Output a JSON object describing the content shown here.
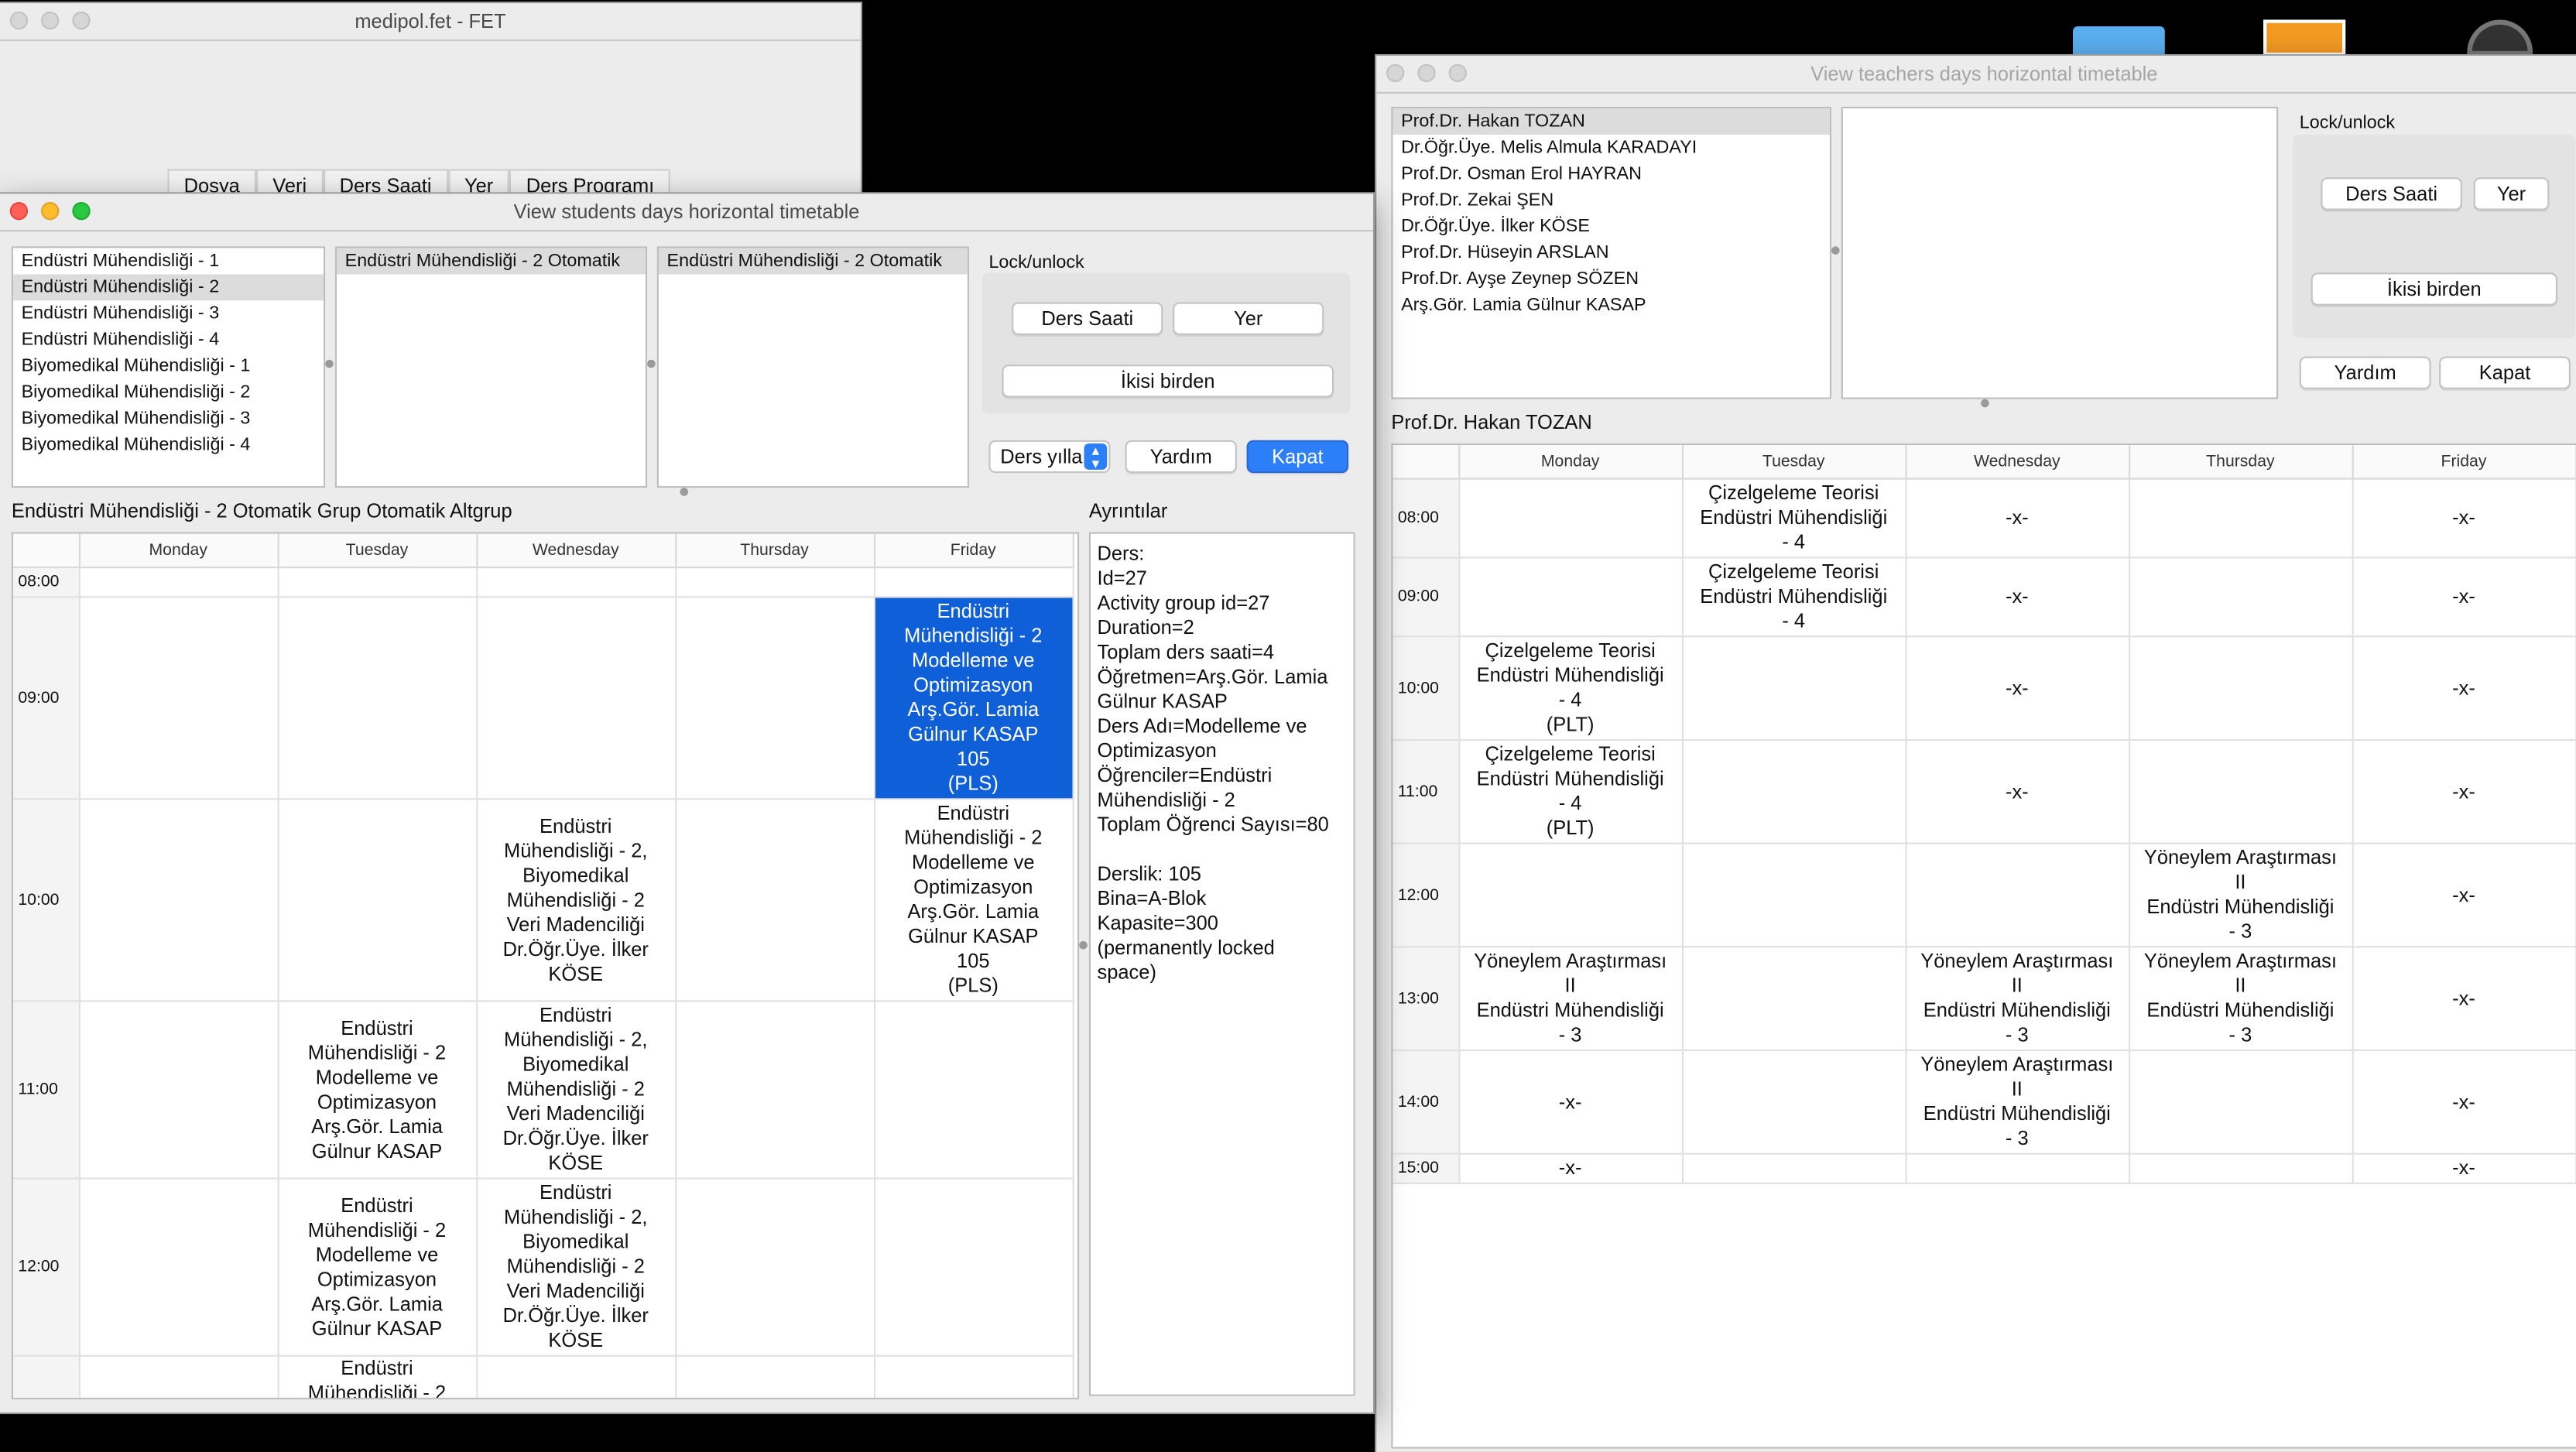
{
  "desktop": {
    "icons": [
      "folder-icon",
      "document-icon",
      "drive-icon"
    ]
  },
  "main_window": {
    "title": "medipol.fet - FET",
    "menu": [
      "Dosya",
      "Veri",
      "Ders Saati",
      "Yer",
      "Ders Programı"
    ]
  },
  "students_window": {
    "title": "View students days horizontal timetable",
    "year_list": [
      "Endüstri Mühendisliği - 1",
      "Endüstri Mühendisliği - 2",
      "Endüstri Mühendisliği - 3",
      "Endüstri Mühendisliği - 4",
      "Biyomedikal Mühendisliği - 1",
      "Biyomedikal Mühendisliği - 2",
      "Biyomedikal Mühendisliği - 3",
      "Biyomedikal Mühendisliği - 4"
    ],
    "group_list": [
      "Endüstri Mühendisliği - 2 Otomatik"
    ],
    "subgroup_list": [
      "Endüstri Mühendisliği - 2 Otomatik"
    ],
    "lock_label": "Lock/unlock",
    "btn_ders_saati": "Ders Saati",
    "btn_yer": "Yer",
    "btn_ikisi": "İkisi birden",
    "select_value": "Ders yılla",
    "btn_yardim": "Yardım",
    "btn_kapat": "Kapat",
    "table_title": "Endüstri Mühendisliği - 2 Otomatik Grup Otomatik Altgrup",
    "days": [
      "Monday",
      "Tuesday",
      "Wednesday",
      "Thursday",
      "Friday"
    ],
    "rows": [
      {
        "hour": "08:00",
        "cells": [
          "",
          "",
          "",
          "",
          ""
        ]
      },
      {
        "hour": "09:00",
        "cells": [
          "",
          "",
          "",
          "",
          "Endüstri\nMühendisliği - 2\nModelleme ve\nOptimizasyon\nArş.Gör. Lamia\nGülnur KASAP\n105\n(PLS)"
        ]
      },
      {
        "hour": "10:00",
        "cells": [
          "",
          "",
          "Endüstri\nMühendisliği - 2,\nBiyomedikal\nMühendisliği - 2\nVeri Madenciliği\nDr.Öğr.Üye. İlker\nKÖSE",
          "",
          "Endüstri\nMühendisliği - 2\nModelleme ve\nOptimizasyon\nArş.Gör. Lamia\nGülnur KASAP\n105\n(PLS)"
        ]
      },
      {
        "hour": "11:00",
        "cells": [
          "",
          "Endüstri\nMühendisliği - 2\nModelleme ve\nOptimizasyon\nArş.Gör. Lamia\nGülnur KASAP",
          "Endüstri\nMühendisliği - 2,\nBiyomedikal\nMühendisliği - 2\nVeri Madenciliği\nDr.Öğr.Üye. İlker\nKÖSE",
          "",
          ""
        ]
      },
      {
        "hour": "12:00",
        "cells": [
          "",
          "Endüstri\nMühendisliği - 2\nModelleme ve\nOptimizasyon\nArş.Gör. Lamia\nGülnur KASAP",
          "Endüstri\nMühendisliği - 2,\nBiyomedikal\nMühendisliği - 2\nVeri Madenciliği\nDr.Öğr.Üye. İlker\nKÖSE",
          "",
          ""
        ]
      },
      {
        "hour": "",
        "cells": [
          "",
          "Endüstri\nMühendisliği - 2",
          "",
          "",
          ""
        ]
      }
    ],
    "details_label": "Ayrıntılar",
    "details_text": "Ders:\nId=27\nActivity group id=27\nDuration=2\nToplam ders saati=4\nÖğretmen=Arş.Gör. Lamia\nGülnur KASAP\nDers Adı=Modelleme ve\nOptimizasyon\nÖğrenciler=Endüstri\nMühendisliği - 2\nToplam Öğrenci Sayısı=80\n\nDerslik: 105\nBina=A-Blok\nKapasite=300\n(permanently locked\nspace)"
  },
  "teachers_window": {
    "title": "View teachers days horizontal timetable",
    "teacher_list": [
      "Prof.Dr. Hakan TOZAN",
      "Dr.Öğr.Üye. Melis Almula KARADAYI",
      "Prof.Dr. Osman Erol HAYRAN",
      "Prof.Dr. Zekai ŞEN",
      "Dr.Öğr.Üye. İlker KÖSE",
      "Prof.Dr. Hüseyin ARSLAN",
      "Prof.Dr. Ayşe Zeynep SÖZEN",
      "Arş.Gör. Lamia Gülnur KASAP"
    ],
    "lock_label": "Lock/unlock",
    "btn_ders_saati": "Ders Saati",
    "btn_yer": "Yer",
    "btn_ikisi": "İkisi birden",
    "btn_yardim": "Yardım",
    "btn_kapat": "Kapat",
    "table_title": "Prof.Dr. Hakan TOZAN",
    "days": [
      "Monday",
      "Tuesday",
      "Wednesday",
      "Thursday",
      "Friday"
    ],
    "rows": [
      {
        "hour": "08:00",
        "cells": [
          "",
          "Çizelgeleme Teorisi\nEndüstri Mühendisliği\n- 4",
          "-x-",
          "",
          "-x-"
        ]
      },
      {
        "hour": "09:00",
        "cells": [
          "",
          "Çizelgeleme Teorisi\nEndüstri Mühendisliği\n- 4",
          "-x-",
          "",
          "-x-"
        ]
      },
      {
        "hour": "10:00",
        "cells": [
          "Çizelgeleme Teorisi\nEndüstri Mühendisliği\n- 4\n(PLT)",
          "",
          "-x-",
          "",
          "-x-"
        ]
      },
      {
        "hour": "11:00",
        "cells": [
          "Çizelgeleme Teorisi\nEndüstri Mühendisliği\n- 4\n(PLT)",
          "",
          "-x-",
          "",
          "-x-"
        ]
      },
      {
        "hour": "12:00",
        "cells": [
          "",
          "",
          "",
          "Yöneylem Araştırması\nII\nEndüstri Mühendisliği\n- 3",
          "-x-"
        ]
      },
      {
        "hour": "13:00",
        "cells": [
          "Yöneylem Araştırması\nII\nEndüstri Mühendisliği\n- 3",
          "",
          "Yöneylem Araştırması\nII\nEndüstri Mühendisliği\n- 3",
          "Yöneylem Araştırması\nII\nEndüstri Mühendisliği\n- 3",
          "-x-"
        ]
      },
      {
        "hour": "14:00",
        "cells": [
          "-x-",
          "",
          "Yöneylem Araştırması\nII\nEndüstri Mühendisliği\n- 3",
          "",
          "-x-"
        ]
      },
      {
        "hour": "15:00",
        "cells": [
          "-x-",
          "",
          "",
          "",
          "-x-"
        ]
      }
    ]
  }
}
